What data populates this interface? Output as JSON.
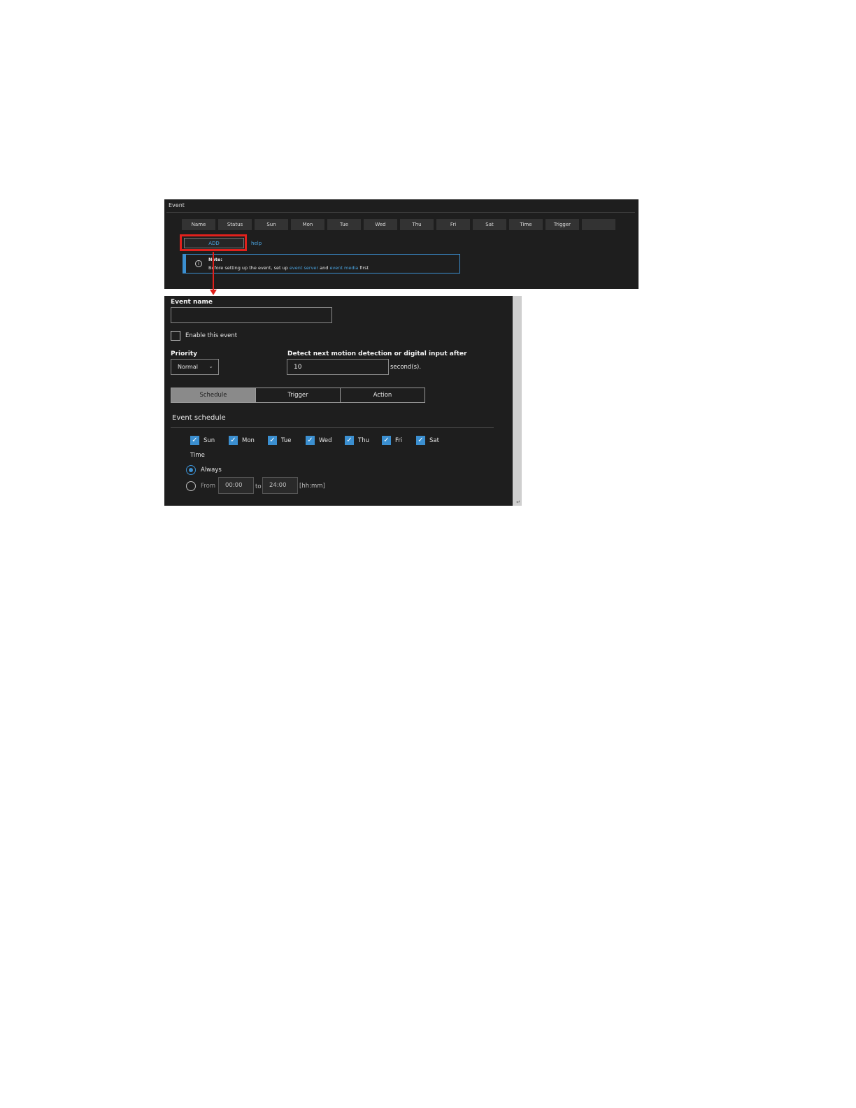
{
  "event_list": {
    "title": "Event",
    "columns": [
      "Name",
      "Status",
      "Sun",
      "Mon",
      "Tue",
      "Wed",
      "Thu",
      "Fri",
      "Sat",
      "Time",
      "Trigger",
      ""
    ],
    "add_label": "ADD",
    "help_label": "help",
    "note": {
      "title": "Note:",
      "text_before": "Before setting up the event, set up ",
      "link1": "event server",
      "text_mid": " and ",
      "link2": "event media",
      "text_after": " first"
    }
  },
  "settings": {
    "event_name_label": "Event name",
    "event_name_value": "",
    "enable_label": "Enable this event",
    "enable_checked": false,
    "priority_label": "Priority",
    "priority_value": "Normal",
    "detect_label": "Detect next motion detection or digital input after",
    "detect_value": "10",
    "seconds_label": "second(s).",
    "tabs": [
      {
        "label": "Schedule",
        "active": true
      },
      {
        "label": "Trigger",
        "active": false
      },
      {
        "label": "Action",
        "active": false
      }
    ],
    "schedule_heading": "Event schedule",
    "days": [
      {
        "label": "Sun",
        "checked": true
      },
      {
        "label": "Mon",
        "checked": true
      },
      {
        "label": "Tue",
        "checked": true
      },
      {
        "label": "Wed",
        "checked": true
      },
      {
        "label": "Thu",
        "checked": true
      },
      {
        "label": "Fri",
        "checked": true
      },
      {
        "label": "Sat",
        "checked": true
      }
    ],
    "time_label": "Time",
    "always_label": "Always",
    "from_label": "From",
    "from_value": "00:00",
    "to_label": "to",
    "to_value": "24:00",
    "format_label": "[hh:mm]",
    "selected_time_mode": "Always"
  },
  "colors": {
    "panel_bg": "#1e1e1e",
    "accent_blue": "#3b8fd0",
    "link_blue": "#4aa3df",
    "highlight_red": "#e1211c"
  }
}
